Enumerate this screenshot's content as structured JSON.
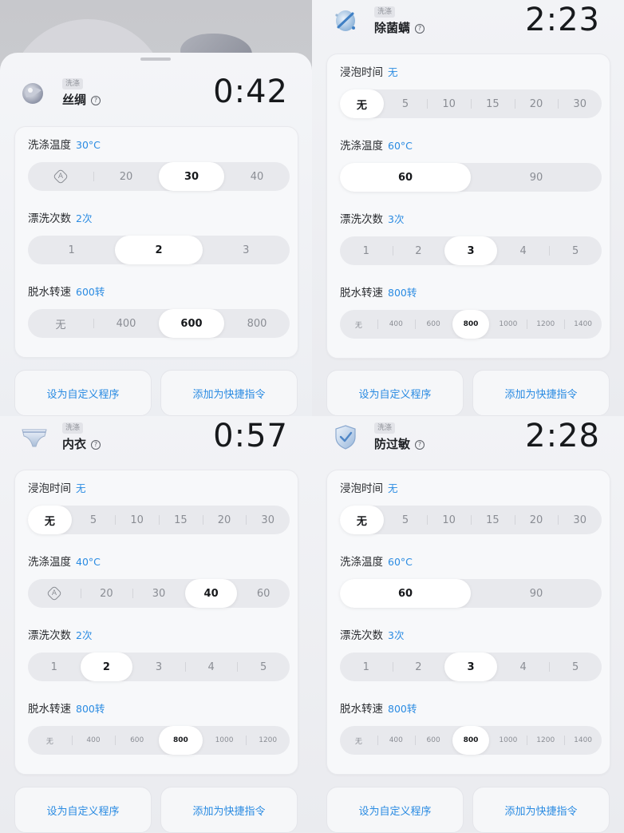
{
  "colors": {
    "accent": "#2a8be2",
    "selected_bg": "#ffffff",
    "track_bg": "#e8e9ed"
  },
  "panels": [
    {
      "tag": "洗涤",
      "name": "丝绸",
      "icon": "silk-icon",
      "help_glyph": "?",
      "timer": "0:42",
      "settings": [
        {
          "label": "洗涤温度",
          "value": "30°C",
          "options": [
            "auto",
            "20",
            "30",
            "40"
          ],
          "selected": 2
        },
        {
          "label": "漂洗次数",
          "value": "2次",
          "options": [
            "1",
            "2",
            "3"
          ],
          "selected": 1
        },
        {
          "label": "脱水转速",
          "value": "600转",
          "options": [
            "无",
            "400",
            "600",
            "800"
          ],
          "selected": 2
        }
      ],
      "buttons": {
        "custom": "设为自定义程序",
        "shortcut": "添加为快捷指令"
      }
    },
    {
      "tag": "洗涤",
      "name": "除菌螨",
      "icon": "mite-removal-icon",
      "help_glyph": "?",
      "timer": "2:23",
      "settings": [
        {
          "label": "浸泡时间",
          "value": "无",
          "options": [
            "无",
            "5",
            "10",
            "15",
            "20",
            "30"
          ],
          "selected": 0
        },
        {
          "label": "洗涤温度",
          "value": "60°C",
          "options": [
            "60",
            "90"
          ],
          "selected": 0
        },
        {
          "label": "漂洗次数",
          "value": "3次",
          "options": [
            "1",
            "2",
            "3",
            "4",
            "5"
          ],
          "selected": 2
        },
        {
          "label": "脱水转速",
          "value": "800转",
          "options": [
            "无",
            "400",
            "600",
            "800",
            "1000",
            "1200",
            "1400"
          ],
          "selected": 3
        }
      ],
      "buttons": {
        "custom": "设为自定义程序",
        "shortcut": "添加为快捷指令"
      }
    },
    {
      "tag": "洗涤",
      "name": "内衣",
      "icon": "underwear-icon",
      "help_glyph": "?",
      "timer": "0:57",
      "settings": [
        {
          "label": "浸泡时间",
          "value": "无",
          "options": [
            "无",
            "5",
            "10",
            "15",
            "20",
            "30"
          ],
          "selected": 0
        },
        {
          "label": "洗涤温度",
          "value": "40°C",
          "options": [
            "auto",
            "20",
            "30",
            "40",
            "60"
          ],
          "selected": 3
        },
        {
          "label": "漂洗次数",
          "value": "2次",
          "options": [
            "1",
            "2",
            "3",
            "4",
            "5"
          ],
          "selected": 1
        },
        {
          "label": "脱水转速",
          "value": "800转",
          "options": [
            "无",
            "400",
            "600",
            "800",
            "1000",
            "1200"
          ],
          "selected": 3
        }
      ],
      "buttons": {
        "custom": "设为自定义程序",
        "shortcut": "添加为快捷指令"
      }
    },
    {
      "tag": "洗涤",
      "name": "防过敏",
      "icon": "anti-allergy-shield-icon",
      "help_glyph": "?",
      "timer": "2:28",
      "settings": [
        {
          "label": "浸泡时间",
          "value": "无",
          "options": [
            "无",
            "5",
            "10",
            "15",
            "20",
            "30"
          ],
          "selected": 0
        },
        {
          "label": "洗涤温度",
          "value": "60°C",
          "options": [
            "60",
            "90"
          ],
          "selected": 0
        },
        {
          "label": "漂洗次数",
          "value": "3次",
          "options": [
            "1",
            "2",
            "3",
            "4",
            "5"
          ],
          "selected": 2
        },
        {
          "label": "脱水转速",
          "value": "800转",
          "options": [
            "无",
            "400",
            "600",
            "800",
            "1000",
            "1200",
            "1400"
          ],
          "selected": 3
        }
      ],
      "buttons": {
        "custom": "设为自定义程序",
        "shortcut": "添加为快捷指令"
      }
    }
  ]
}
